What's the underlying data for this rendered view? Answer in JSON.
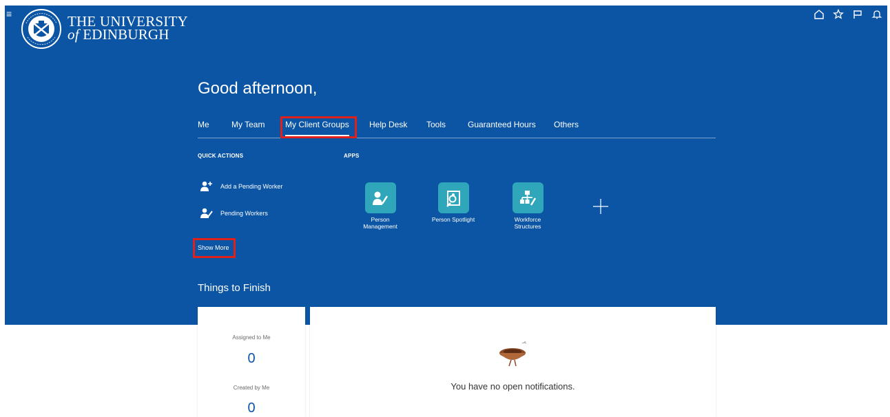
{
  "header": {
    "university_line1": "THE UNIVERSITY",
    "university_line2_prefix": "of",
    "university_line2_name": "EDINBURGH",
    "global_icons": [
      "home-icon",
      "favorites-icon",
      "flag-icon",
      "notifications-icon"
    ]
  },
  "greeting": "Good afternoon,",
  "tabs": [
    {
      "label": "Me"
    },
    {
      "label": "My Team"
    },
    {
      "label": "My Client Groups",
      "selected": true
    },
    {
      "label": "Help Desk"
    },
    {
      "label": "Tools"
    },
    {
      "label": "Guaranteed Hours"
    },
    {
      "label": "Others"
    }
  ],
  "quick_actions": {
    "heading": "QUICK ACTIONS",
    "items": [
      {
        "label": "Add a Pending Worker",
        "icon": "add-pending-worker-icon"
      },
      {
        "label": "Pending Workers",
        "icon": "pending-workers-icon"
      }
    ],
    "show_more": "Show More"
  },
  "apps": {
    "heading": "APPS",
    "items": [
      {
        "label_line1": "Person",
        "label_line2": "Management",
        "icon": "person-management-icon"
      },
      {
        "label_line1": "Person Spotlight",
        "label_line2": "",
        "icon": "person-spotlight-icon"
      },
      {
        "label_line1": "Workforce",
        "label_line2": "Structures",
        "icon": "workforce-structures-icon"
      }
    ]
  },
  "things_to_finish": {
    "title": "Things to Finish",
    "assigned_label": "Assigned to Me",
    "assigned_count": "0",
    "created_label": "Created by Me",
    "created_count": "0"
  },
  "notifications": {
    "empty_message": "You have no open notifications."
  },
  "colors": {
    "brand_blue": "#0b55a4",
    "app_tile": "#2fa6b9",
    "highlight": "#e0201a"
  }
}
